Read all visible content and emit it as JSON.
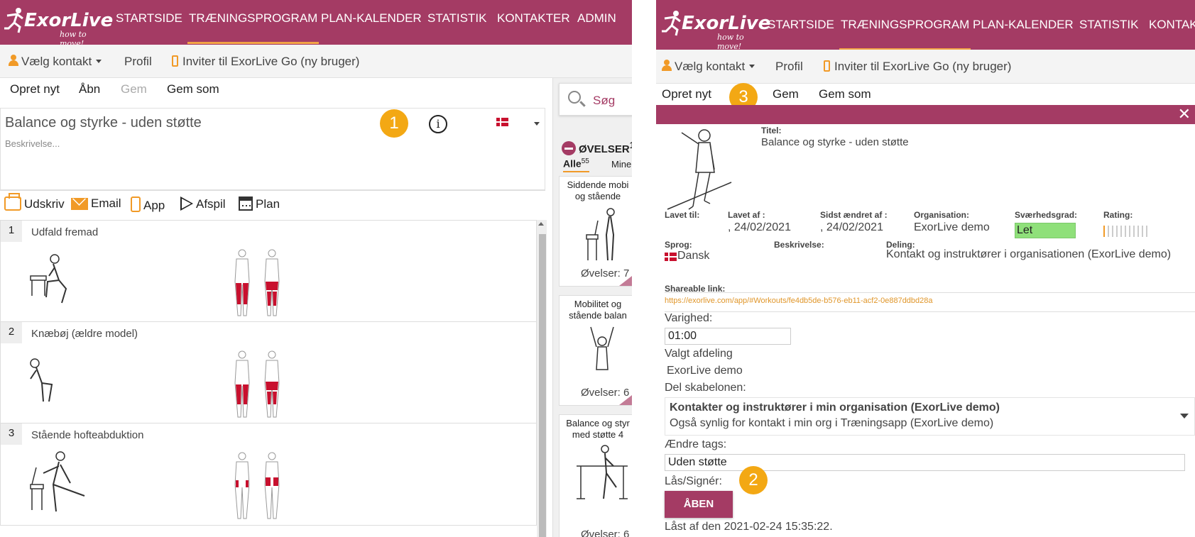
{
  "brand": {
    "logo_text": "ExorLive",
    "tagline": "how to move!"
  },
  "nav": {
    "items": [
      "STARTSIDE",
      "TRÆNINGSPROGRAM",
      "PLAN-KALENDER",
      "STATISTIK",
      "KONTAKTER",
      "ADMIN"
    ],
    "right_items": [
      "STARTSIDE",
      "TRÆNINGSPROGRAM",
      "PLAN-KALENDER",
      "STATISTIK",
      "KONTAK"
    ]
  },
  "subbar": {
    "contact": "Vælg kontakt",
    "profile": "Profil",
    "invite": "Inviter til ExorLive Go (ny bruger)"
  },
  "menu": {
    "new": "Opret nyt",
    "open": "Åbn",
    "save": "Gem",
    "save_as": "Gem som"
  },
  "workout": {
    "title": "Balance og styrke - uden støtte",
    "description_placeholder": "Beskrivelse..."
  },
  "badges": {
    "one": "1",
    "two": "2",
    "three": "3"
  },
  "actions": {
    "print": "Udskriv",
    "email": "Email",
    "app": "App",
    "play": "Afspil",
    "plan": "Plan"
  },
  "exercises": [
    {
      "num": "1",
      "name": "Udfald fremad"
    },
    {
      "num": "2",
      "name": "Knæbøj (ældre model)"
    },
    {
      "num": "3",
      "name": "Stående hofteabduktion"
    }
  ],
  "side": {
    "search": "Søg",
    "heading": "ØVELSER",
    "heading_sup": "1",
    "tab_all": "Alle",
    "tab_all_count": "55",
    "tab_mine": "Mine",
    "cards": [
      {
        "title": "Siddende mobi og stående",
        "count": "Øvelser: 7"
      },
      {
        "title": "Mobilitet og stående balan",
        "count": "Øvelser: 6"
      },
      {
        "title": "Balance og styr med støtte 4",
        "count": "Øvelser: 6"
      }
    ]
  },
  "detail": {
    "title_label": "Titel:",
    "title": "Balance og styrke - uden støtte",
    "made_for_label": "Lavet til:",
    "made_by_label": "Lavet af :",
    "made_by": ", 24/02/2021",
    "changed_label": "Sidst ændret af :",
    "changed": ", 24/02/2021",
    "org_label": "Organisation:",
    "org": "ExorLive demo",
    "difficulty_label": "Sværhedsgrad:",
    "difficulty": "Let",
    "rating_label": "Rating:",
    "language_label": "Sprog:",
    "language": "Dansk",
    "desc_label": "Beskrivelse:",
    "sharing_label": "Deling:",
    "sharing": "Kontakt og instruktører i organisationen (ExorLive demo)",
    "link_label": "Shareable link:",
    "link": "https://exorlive.com/app/#Workouts/fe4db5de-b576-eb11-acf2-0e887ddbd28a",
    "duration_label": "Varighed:",
    "duration": "01:00",
    "dept_label": "Valgt afdeling",
    "dept": "ExorLive demo",
    "share_template_label": "Del skabelonen:",
    "share_option_title": "Kontakter og instruktører i min organisation (ExorLive demo)",
    "share_option_sub": "Også synlig for kontakt i min org i Træningsapp (ExorLive demo)",
    "tags_label": "Ændre tags:",
    "tags": "Uden støtte",
    "lock_label": "Lås/Signér:",
    "open_button": "ÅBEN",
    "locked_text": "Låst af den 2021-02-24 15:35:22."
  },
  "colors": {
    "brand": "#a43b64",
    "accent": "#f19a27",
    "badge": "#f3a814",
    "difficulty": "#8fe07a"
  }
}
